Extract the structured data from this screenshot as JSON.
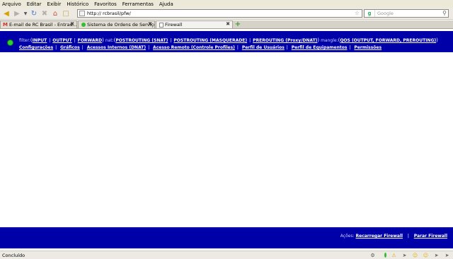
{
  "menubar": {
    "items": [
      "Arquivo",
      "Editar",
      "Exibir",
      "Histórico",
      "Favoritos",
      "Ferramentas",
      "Ajuda"
    ]
  },
  "navbar": {
    "url": "http://            rcbrasil/pfw/",
    "search_placeholder": "Google"
  },
  "tabs": [
    {
      "label": "E-mail de RC Brasil - Entrad...",
      "icon": "gmail-icon"
    },
    {
      "label": "Sistema de Ordens de Serviço",
      "icon": "green-dot-icon"
    },
    {
      "label": "Firewall",
      "icon": "page-icon"
    }
  ],
  "header": {
    "filter_label": "filter:",
    "filter_links": [
      "INPUT",
      "OUTPUT",
      "FORWARD"
    ],
    "nat_label": "nat:",
    "nat_links": [
      "POSTROUTING (SNAT)",
      "POSTROUTING (MASQUERADE)",
      "PREROUTING (Proxy/DNAT)"
    ],
    "mangle_label": "mangle:",
    "mangle_links": [
      "QOS (OUTPUT, FORWARD, PREROUTING)"
    ],
    "row2_links": [
      "Configurações",
      "Gráficos",
      "Acessos Internos (DNAT)",
      "Acesso Remoto (Controle Profiles)",
      "Perfil de Usuários",
      "Perfil de Equipamentos",
      "Permissões"
    ]
  },
  "footer": {
    "actions_label": "Ações:",
    "reload_link": "Recarregar Firewall",
    "stop_link": "Parar Firewall"
  },
  "statusbar": {
    "text": "Concluído"
  }
}
